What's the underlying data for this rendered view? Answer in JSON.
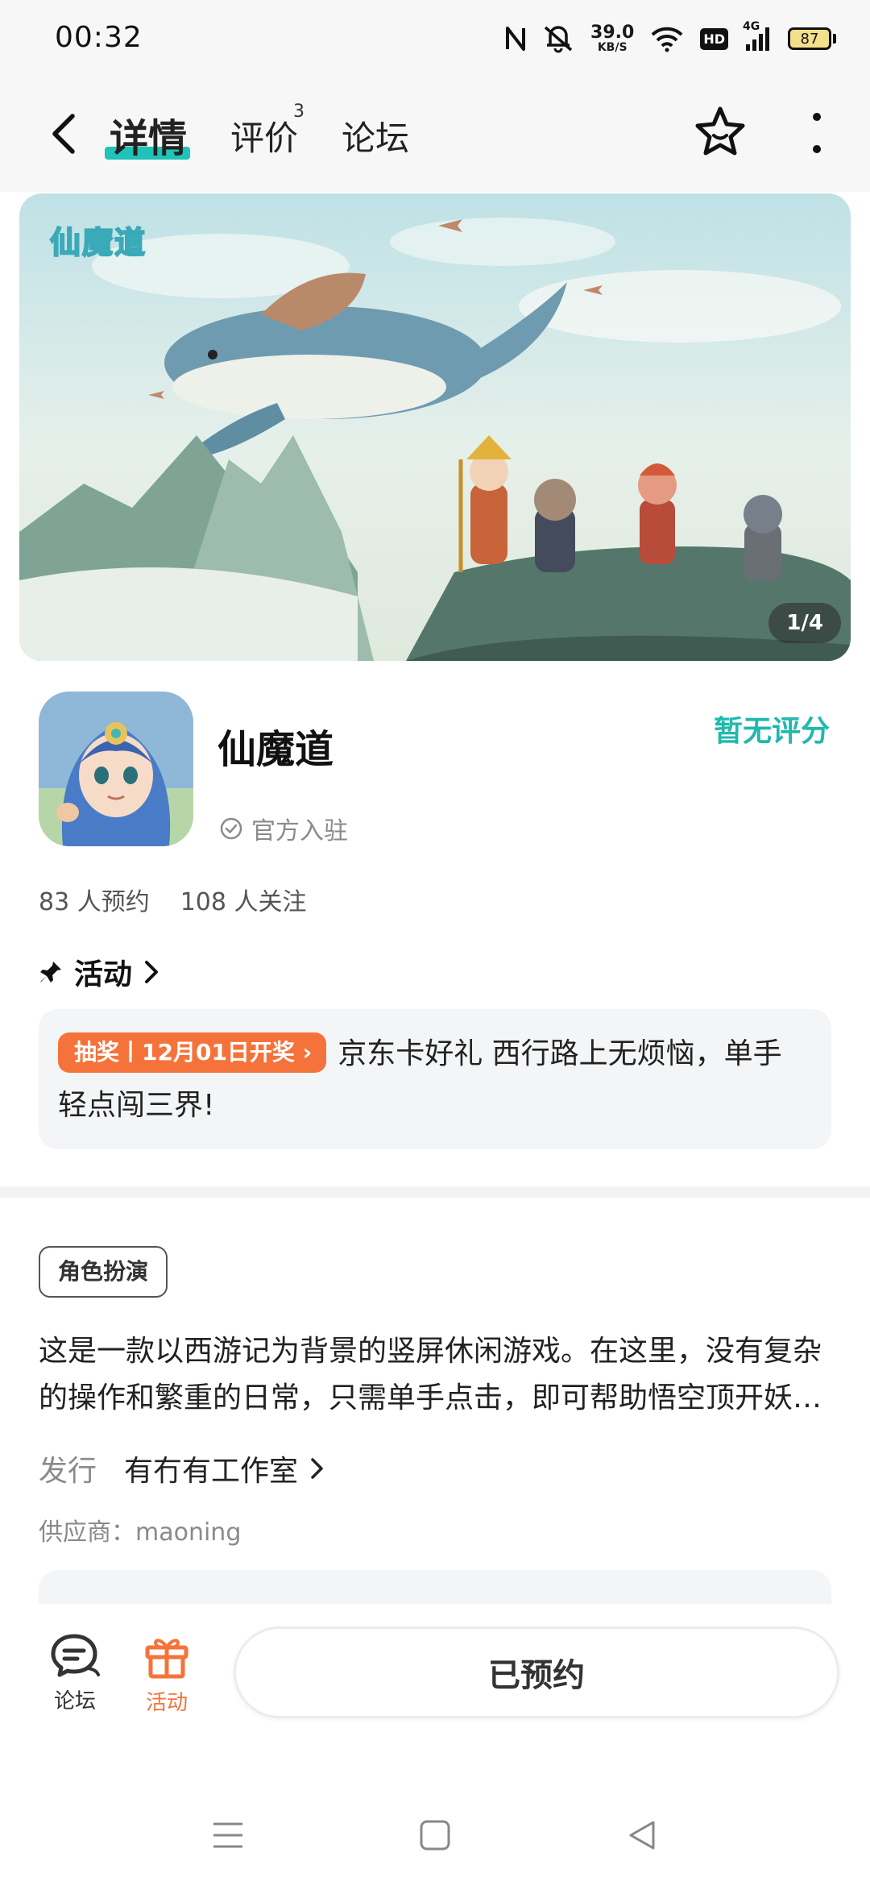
{
  "status_bar": {
    "time": "00:32",
    "net_speed_value": "39.0",
    "net_speed_unit": "KB/S",
    "hd": "HD",
    "network": "4G",
    "battery": "87",
    "icons": [
      "nfc-icon",
      "mute-icon",
      "wifi-icon",
      "signal-icon",
      "battery-icon"
    ]
  },
  "nav": {
    "tabs": [
      {
        "label": "详情",
        "active": true
      },
      {
        "label": "评价",
        "badge": "3"
      },
      {
        "label": "论坛"
      }
    ],
    "accent_color": "#21c2b8"
  },
  "banner": {
    "logo_text": "仙魔道",
    "counter": "1/4"
  },
  "app": {
    "name": "仙魔道",
    "official_label": "官方入驻",
    "rating_text": "暂无评分",
    "stats": [
      {
        "label": "83 人预约"
      },
      {
        "label": "108 人关注"
      }
    ]
  },
  "activity": {
    "header": "活动",
    "tag": "抽奖丨12月01日开奖",
    "tag_color": "#f5733a",
    "text": "京东卡好礼 西行路上无烦恼，单手轻点闯三界!"
  },
  "details": {
    "genre": "角色扮演",
    "description": "这是一款以西游记为背景的竖屏休闲游戏。在这里，没有复杂的操作和繁重的日常，只需单手点击，即可帮助悟空顶开妖…",
    "publisher_label": "发行",
    "publisher_name": "有冇有工作室",
    "supplier": "供应商：maoning"
  },
  "bottom_bar": {
    "forum_label": "论坛",
    "activity_label": "活动",
    "activity_color": "#f5733a",
    "reserve_button": "已预约"
  }
}
